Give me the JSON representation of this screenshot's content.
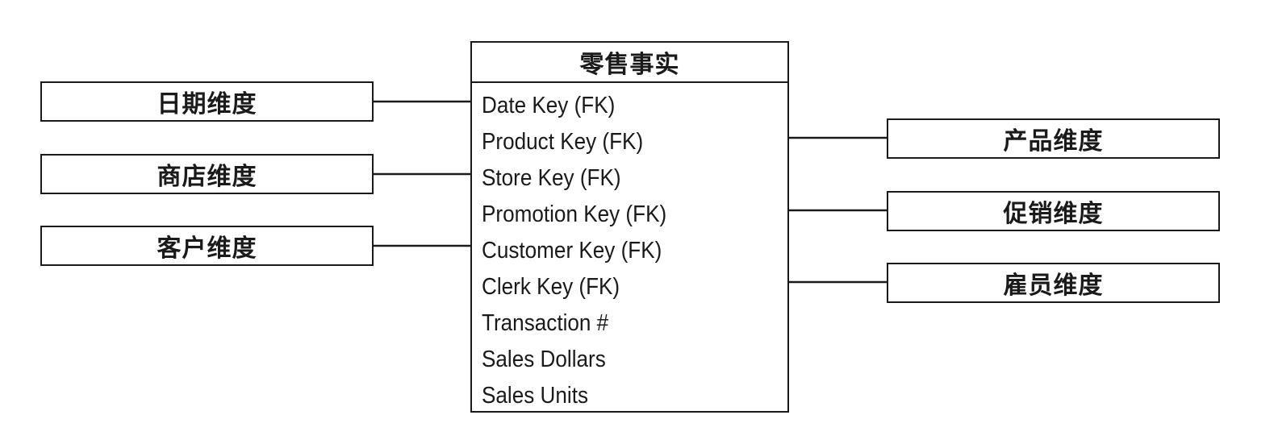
{
  "fact_table": {
    "title": "零售事实",
    "fields": [
      "Date Key (FK)",
      "Product Key (FK)",
      "Store Key (FK)",
      "Promotion Key (FK)",
      "Customer Key (FK)",
      "Clerk Key (FK)",
      "Transaction #",
      "Sales Dollars",
      "Sales Units"
    ]
  },
  "left_dimensions": [
    {
      "label": "日期维度",
      "links_to": "Date Key (FK)"
    },
    {
      "label": "商店维度",
      "links_to": "Store Key (FK)"
    },
    {
      "label": "客户维度",
      "links_to": "Customer Key (FK)"
    }
  ],
  "right_dimensions": [
    {
      "label": "产品维度",
      "links_to": "Product Key (FK)"
    },
    {
      "label": "促销维度",
      "links_to": "Promotion Key (FK)"
    },
    {
      "label": "雇员维度",
      "links_to": "Clerk Key (FK)"
    }
  ]
}
